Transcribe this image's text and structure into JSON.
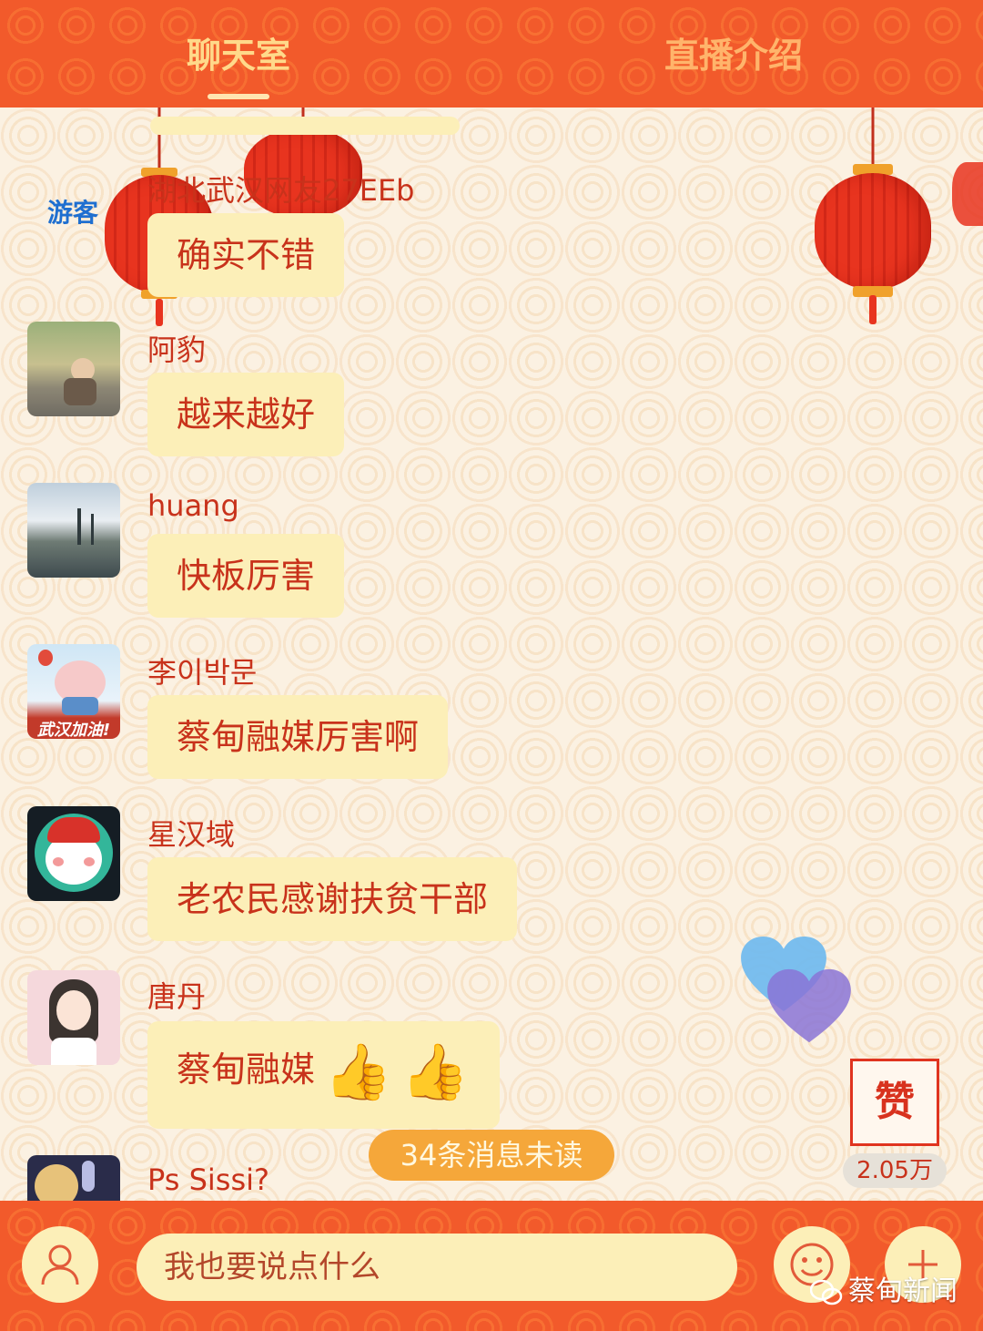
{
  "tabs": {
    "chat": "聊天室",
    "intro": "直播介绍"
  },
  "messages": [
    {
      "user": "湖北武汉网友27EEb",
      "text": "确实不错",
      "avatar": "guest",
      "guest_label": "游客"
    },
    {
      "user": "阿豹",
      "text": "越来越好",
      "avatar": "photo-monk-child"
    },
    {
      "user": "huang",
      "text": "快板厉害",
      "avatar": "photo-harbor"
    },
    {
      "user": "李이박문",
      "text": "蔡甸融媒厉害啊",
      "avatar": "pig-cartoon",
      "avatar_caption": "武汉加油!"
    },
    {
      "user": "星汉域",
      "text": "老农民感谢扶贫干部",
      "avatar": "snowman-cartoon"
    },
    {
      "user": "唐丹",
      "text": "蔡甸融媒",
      "avatar": "girl-cartoon",
      "emoji": [
        "thumbs-up-icon",
        "thumbs-up-icon"
      ]
    },
    {
      "user": "Ps Sissi?",
      "avatar": "bunny-moon"
    }
  ],
  "unread": "34条消息未读",
  "like": {
    "label": "赞",
    "count": "2.05万"
  },
  "input": {
    "placeholder": "我也要说点什么"
  },
  "watermark": "蔡甸新闻",
  "colors": {
    "header": "#f25a2b",
    "bubble": "#fcefb8",
    "text_red": "#c8321b",
    "guest_blue": "#1f6fd0"
  }
}
